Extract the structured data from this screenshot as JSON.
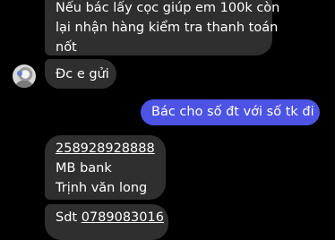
{
  "messages": [
    {
      "sender": "contact",
      "lines": [
        "Nếu bác lấy cọc giúp em 100k còn",
        "lại nhận hàng kiểm tra thanh toán",
        "nốt"
      ]
    },
    {
      "sender": "contact",
      "text": "Đc e gửi"
    },
    {
      "sender": "me",
      "text": "Bác cho số đt với số tk đi"
    },
    {
      "sender": "contact",
      "account_number": "258928928888",
      "bank": "MB bank",
      "account_name": "Trịnh văn long"
    },
    {
      "sender": "contact",
      "phone_label": "Sdt",
      "phone_number": "0789083016"
    }
  ],
  "colors": {
    "background": "#000000",
    "incoming_bubble": "#2f2f2f",
    "outgoing_bubble": "#4d53e4",
    "text": "#ffffff"
  },
  "icons": {
    "contact_avatar": "avatar"
  }
}
